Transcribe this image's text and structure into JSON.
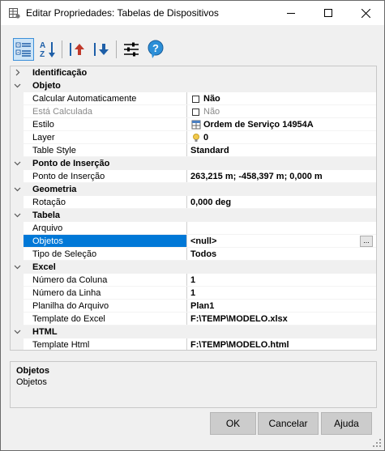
{
  "window": {
    "title": "Editar Propriedades: Tabelas de Dispositivos"
  },
  "toolbar": {
    "buttons": [
      {
        "icon": "categorized-icon",
        "active": true
      },
      {
        "icon": "sort-alpha-icon",
        "active": false
      },
      {
        "icon": "move-up-icon",
        "active": false
      },
      {
        "icon": "move-down-icon",
        "active": false
      },
      {
        "icon": "settings-sliders-icon",
        "active": false
      },
      {
        "icon": "help-balloon-icon",
        "active": false
      }
    ]
  },
  "grid": {
    "rows": [
      {
        "type": "category",
        "label": "Identificação",
        "expanded": false
      },
      {
        "type": "category",
        "label": "Objeto",
        "expanded": true
      },
      {
        "type": "prop",
        "name": "Calcular Automaticamente",
        "value": "Não",
        "icon": "checkbox-icon"
      },
      {
        "type": "prop",
        "name": "Está Calculada",
        "value": "Não",
        "icon": "checkbox-icon",
        "disabled": true
      },
      {
        "type": "prop",
        "name": "Estilo",
        "value": "Ordem de Serviço 14954A",
        "icon": "style-icon"
      },
      {
        "type": "prop",
        "name": "Layer",
        "value": "0",
        "icon": "lightbulb-icon"
      },
      {
        "type": "prop",
        "name": "Table Style",
        "value": "Standard"
      },
      {
        "type": "category",
        "label": "Ponto de Inserção",
        "expanded": true
      },
      {
        "type": "prop",
        "name": "Ponto de Inserção",
        "value": "263,215 m; -458,397 m; 0,000 m"
      },
      {
        "type": "category",
        "label": "Geometria",
        "expanded": true
      },
      {
        "type": "prop",
        "name": "Rotação",
        "value": "0,000 deg"
      },
      {
        "type": "category",
        "label": "Tabela",
        "expanded": true
      },
      {
        "type": "prop",
        "name": "Arquivo",
        "value": ""
      },
      {
        "type": "prop",
        "name": "Objetos",
        "value": "<null>",
        "selected": true,
        "ellipsis": "..."
      },
      {
        "type": "prop",
        "name": "Tipo de Seleção",
        "value": "Todos"
      },
      {
        "type": "category",
        "label": "Excel",
        "expanded": true
      },
      {
        "type": "prop",
        "name": "Número da Coluna",
        "value": "1"
      },
      {
        "type": "prop",
        "name": "Número da Linha",
        "value": "1"
      },
      {
        "type": "prop",
        "name": "Planilha do Arquivo",
        "value": "Plan1"
      },
      {
        "type": "prop",
        "name": "Template do Excel",
        "value": "F:\\TEMP\\MODELO.xlsx"
      },
      {
        "type": "category",
        "label": "HTML",
        "expanded": true
      },
      {
        "type": "prop",
        "name": "Template Html",
        "value": "F:\\TEMP\\MODELO.html"
      }
    ]
  },
  "help": {
    "title": "Objetos",
    "description": "Objetos"
  },
  "buttons": {
    "ok": "OK",
    "cancel": "Cancelar",
    "help": "Ajuda"
  }
}
